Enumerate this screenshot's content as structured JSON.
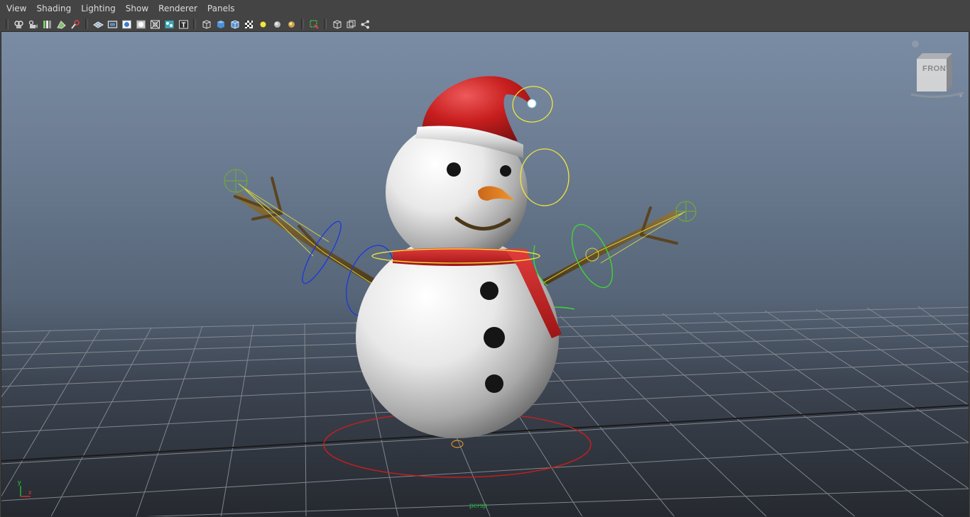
{
  "menubar": {
    "items": [
      "View",
      "Shading",
      "Lighting",
      "Show",
      "Renderer",
      "Panels"
    ]
  },
  "toolbar": {
    "groups": [
      [
        "select-camera-icon",
        "camera-attributes-icon",
        "bookmarks-icon",
        "image-plane-icon",
        "two-d-pan-zoom-icon"
      ],
      [
        "grid-icon",
        "film-gate-icon",
        "resolution-gate-icon",
        "gate-mask-icon",
        "field-chart-icon",
        "safe-action-icon",
        "safe-title-icon"
      ],
      [
        "wireframe-icon",
        "smooth-shade-icon",
        "wireframe-on-shaded-icon",
        "textured-icon",
        "use-all-lights-icon",
        "shadows-icon",
        "ambient-occlusion-icon"
      ],
      [
        "isolate-select-icon"
      ],
      [
        "xray-icon",
        "xray-joints-icon",
        "xray-components-icon"
      ]
    ]
  },
  "viewport": {
    "camera": "persp",
    "viewcube_label": "FRONT",
    "axis": {
      "y": "y",
      "x": "x"
    }
  },
  "colors": {
    "accent_yellow": "#f2e63a",
    "hat_red": "#c81e1e",
    "ik_green": "#41d435",
    "control_blue": "#1b37e0",
    "root_red": "#d91b1b"
  }
}
